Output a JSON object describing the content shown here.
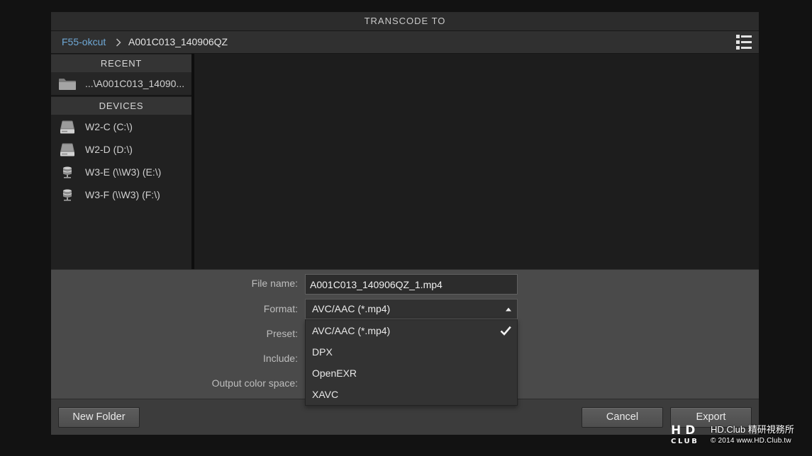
{
  "window": {
    "title": "TRANSCODE TO"
  },
  "breadcrumb": {
    "items": [
      {
        "label": "F55-okcut"
      },
      {
        "label": "A001C013_140906QZ"
      }
    ],
    "separator_icon": "chevron-right-icon",
    "view_toggle_icon": "list-view-icon"
  },
  "sidebar": {
    "recent": {
      "header": "RECENT",
      "items": [
        {
          "label": "...\\A001C013_14090...",
          "icon": "folder-icon"
        }
      ]
    },
    "devices": {
      "header": "DEVICES",
      "items": [
        {
          "label": "W2-C (C:\\)",
          "icon": "hard-drive-icon"
        },
        {
          "label": "W2-D (D:\\)",
          "icon": "hard-drive-icon"
        },
        {
          "label": "W3-E (\\\\W3) (E:\\)",
          "icon": "network-drive-icon"
        },
        {
          "label": "W3-F (\\\\W3) (F:\\)",
          "icon": "network-drive-icon"
        }
      ]
    }
  },
  "form": {
    "file_name": {
      "label": "File name:",
      "value": "A001C013_140906QZ_1.mp4"
    },
    "format": {
      "label": "Format:",
      "value": "AVC/AAC (*.mp4)",
      "expanded": true,
      "selected_index": 0,
      "options": [
        "AVC/AAC (*.mp4)",
        "DPX",
        "OpenEXR",
        "XAVC"
      ],
      "arrow_icon": "caret-up-icon",
      "selected_icon": "checkmark-icon"
    },
    "preset": {
      "label": "Preset:"
    },
    "include": {
      "label": "Include:"
    },
    "output_color_space": {
      "label": "Output color space:"
    }
  },
  "buttons": {
    "new_folder": "New Folder",
    "cancel": "Cancel",
    "export": "Export"
  },
  "watermark": {
    "logo_top": "HD",
    "logo_bottom": "CLUB",
    "brand": "HD.Club 精研視務所",
    "copyright": "© 2014 www.HD.Club.tw"
  },
  "colors": {
    "page_bg": "#121212",
    "panel_bg": "#1d1d1d",
    "form_bg": "#4a4a4a",
    "breadcrumb_link": "#6fa9d6"
  }
}
